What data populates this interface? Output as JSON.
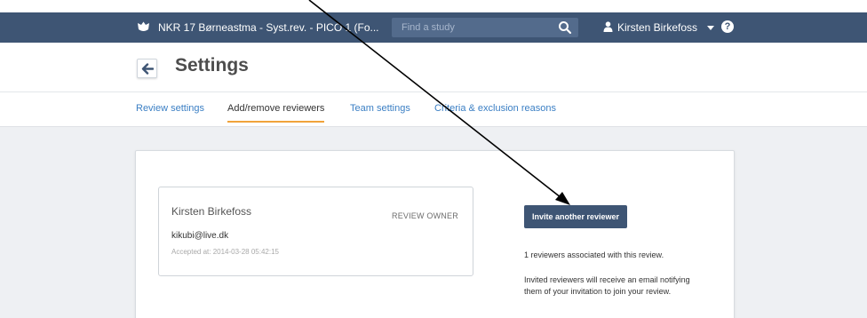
{
  "header": {
    "app_title": "NKR 17 Børneastma - Syst.rev. - PICO 1 (Fo...",
    "search_placeholder": "Find a study",
    "user_name": "Kirsten Birkefoss",
    "help_label": "?",
    "icons": [
      "logo-icon",
      "search-icon",
      "user-icon",
      "caret-down-icon",
      "help-icon"
    ]
  },
  "page": {
    "title": "Settings",
    "back_icon": "arrow-left-icon"
  },
  "tabs": [
    {
      "label": "Review settings",
      "active": false
    },
    {
      "label": "Add/remove reviewers",
      "active": true
    },
    {
      "label": "Team settings",
      "active": false
    },
    {
      "label": "Criteria & exclusion reasons",
      "active": false
    }
  ],
  "reviewer": {
    "name": "Kirsten Birkefoss",
    "role": "REVIEW OWNER",
    "email": "kikubi@live.dk",
    "accepted": "Accepted at: 2014-03-28 05:42:15"
  },
  "invite": {
    "button_label": "Invite another reviewer",
    "count_text": "1 reviewers associated with this review.",
    "info_text": "Invited reviewers will receive an email notifying them of your invitation to join your review."
  },
  "colors": {
    "header_bg": "#3e5574",
    "link": "#3b7fc4",
    "active_tab_underline": "#f0a33a",
    "content_bg": "#eef0f3"
  }
}
